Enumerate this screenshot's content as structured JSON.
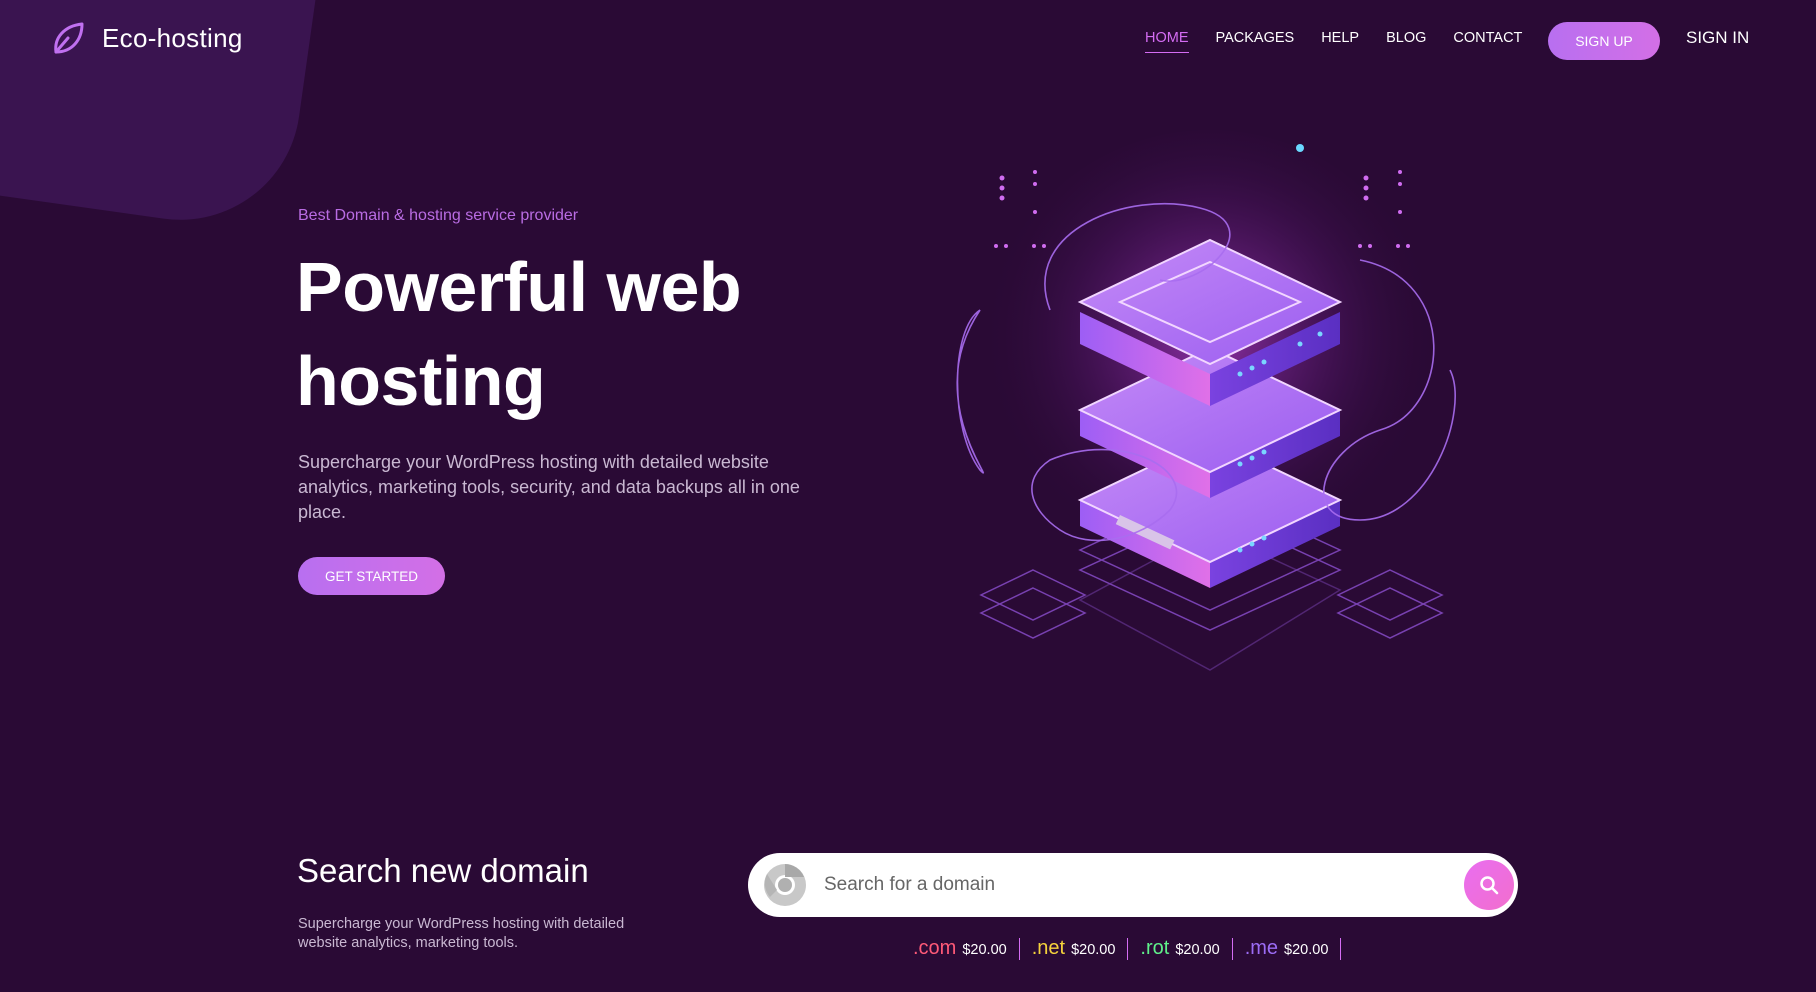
{
  "brand": {
    "name": "Eco-hosting"
  },
  "nav": {
    "items": [
      {
        "label": "HOME",
        "active": true
      },
      {
        "label": "PACKAGES"
      },
      {
        "label": "HELP"
      },
      {
        "label": "BLOG"
      },
      {
        "label": "CONTACT"
      }
    ],
    "signup_label": "SIGN UP",
    "signin_label": "SIGN IN"
  },
  "hero": {
    "eyebrow": "Best Domain & hosting service provider",
    "title": "Powerful web hosting",
    "description": "Supercharge your WordPress hosting with detailed website analytics, marketing tools, security, and data backups all in one place.",
    "cta_label": "GET STARTED"
  },
  "domain": {
    "title": "Search new domain",
    "description": "Supercharge your WordPress hosting with detailed website analytics, marketing tools.",
    "search_placeholder": "Search for a domain",
    "tlds": [
      {
        "name": ".com",
        "price": "$20.00",
        "color": "#ff5a78"
      },
      {
        "name": ".net",
        "price": "$20.00",
        "color": "#f5d23c"
      },
      {
        "name": ".rot",
        "price": "$20.00",
        "color": "#5ff08a"
      },
      {
        "name": ".me",
        "price": "$20.00",
        "color": "#9c6cf5"
      }
    ]
  },
  "colors": {
    "background": "#2a0a35",
    "accent": "#d46cf3",
    "button": "#c070f0"
  },
  "icons": {
    "logo": "leaf-icon",
    "search_lead": "chrome-icon",
    "search_button": "search-icon"
  }
}
